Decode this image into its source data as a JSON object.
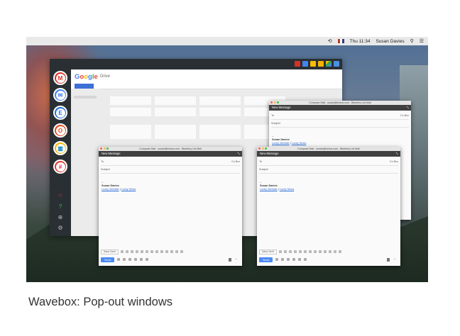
{
  "menubar": {
    "time": "Thu 11:34",
    "user": "Susan Davies"
  },
  "wavebox": {
    "services": [
      {
        "icon": "gmail-icon",
        "glyph": "M",
        "color": "#d93025"
      },
      {
        "icon": "google-inbox-icon",
        "glyph": "✉",
        "color": "#4285f4"
      },
      {
        "icon": "exchange-icon",
        "glyph": "E",
        "color": "#1e6fd9"
      },
      {
        "icon": "office-icon",
        "glyph": "O",
        "color": "#e64a19"
      },
      {
        "icon": "trello-icon",
        "glyph": "▥",
        "color": "#0079bf"
      },
      {
        "icon": "slack-icon",
        "glyph": "#",
        "color": "#e01e5a"
      }
    ],
    "drive": {
      "logo_letters": [
        {
          "ch": "G",
          "color": "#4285f4"
        },
        {
          "ch": "o",
          "color": "#ea4335"
        },
        {
          "ch": "o",
          "color": "#fbbc05"
        },
        {
          "ch": "g",
          "color": "#4285f4"
        },
        {
          "ch": "l",
          "color": "#34a853"
        },
        {
          "ch": "e",
          "color": "#ea4335"
        }
      ],
      "product": "Drive"
    }
  },
  "compose": {
    "window_title": "Compose Mail - susan@tonica.com - Bluebery Ltd Mail",
    "header": "New Message",
    "to_label": "To",
    "cc_bcc": "Cc Bcc",
    "subject_label": "Subject",
    "sig_dashes": "--",
    "sig_name": "Susan Davies",
    "sig_link1": "Lucky Website",
    "sig_sep": "|",
    "sig_link2": "Lucky News",
    "font_label": "Sans Serif",
    "send_label": "Send"
  },
  "caption": "Wavebox: Pop-out windows"
}
